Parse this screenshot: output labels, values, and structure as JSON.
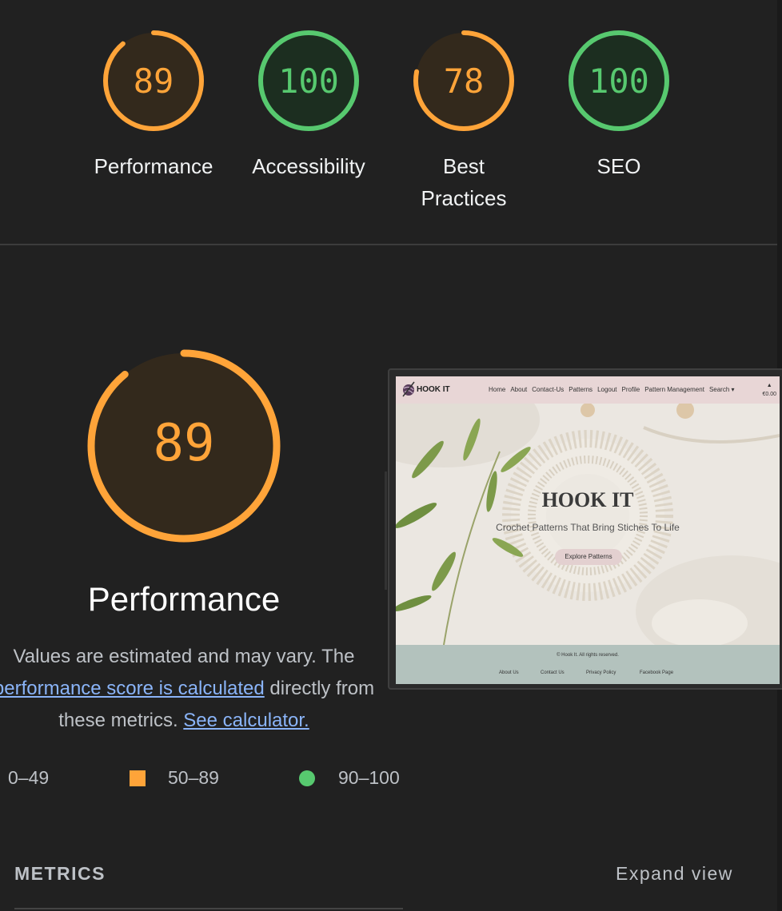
{
  "scores": [
    {
      "value": "89",
      "label": "Performance",
      "score": 89,
      "color": "#ffa439"
    },
    {
      "value": "100",
      "label": "Accessibility",
      "score": 100,
      "color": "#57c96f"
    },
    {
      "value": "78",
      "label": "Best Practices",
      "score": 78,
      "color": "#ffa439"
    },
    {
      "value": "100",
      "label": "SEO",
      "score": 100,
      "color": "#57c96f"
    }
  ],
  "performance": {
    "value": "89",
    "score": 89,
    "title": "Performance",
    "desc_pre": "Values are estimated and may vary. The ",
    "desc_link": "performance score is calculated",
    "desc_mid": " directly from these metrics. ",
    "desc_calc": "See calculator."
  },
  "legend": {
    "low": "0–49",
    "mid": "50–89",
    "high": "90–100"
  },
  "metrics": {
    "title": "METRICS",
    "expand": "Expand view"
  },
  "thumbnail": {
    "logo": "HOOK IT",
    "nav": [
      "Home",
      "About",
      "Contact-Us",
      "Patterns",
      "Logout",
      "Profile",
      "Pattern Management",
      "Search ▾"
    ],
    "cart": "€0.00",
    "hero_title": "HOOK IT",
    "hero_subtitle": "Crochet Patterns That Bring Stiches To Life",
    "hero_button": "Explore Patterns",
    "footer_copy": "© Hook It. All rights reserved.",
    "footer_links": [
      "About Us",
      "Contact Us",
      "Privacy Policy",
      "Facebook Page"
    ]
  },
  "colors": {
    "orange": "#ffa439",
    "green": "#57c96f",
    "bg": "#212121"
  }
}
